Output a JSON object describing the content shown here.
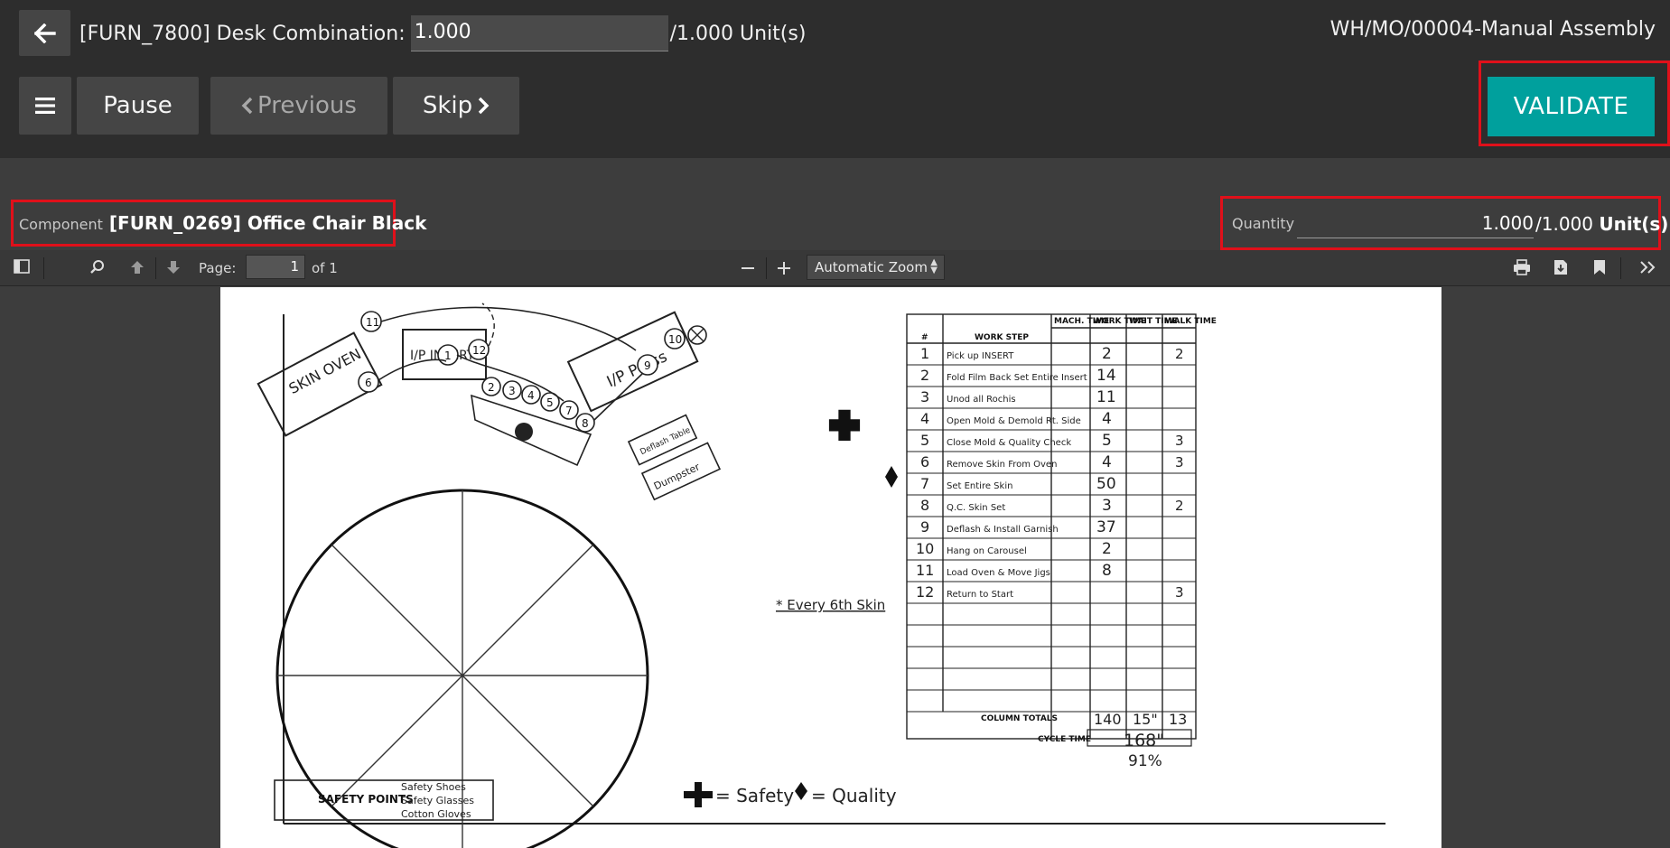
{
  "header": {
    "product": "[FURN_7800] Desk Combination:",
    "quantity_value": "1.000",
    "quantity_total": "/1.000 Unit(s)",
    "order_ref": "WH/MO/00004-Manual Assembly"
  },
  "toolbar": {
    "pause_label": "Pause",
    "previous_label": "Previous",
    "skip_label": "Skip",
    "validate_label": "VALIDATE"
  },
  "component": {
    "label": "Component",
    "value": "[FURN_0269] Office Chair Black"
  },
  "quantity": {
    "label": "Quantity",
    "done": "1.000",
    "total": "/1.000",
    "unit": "Unit(s)"
  },
  "pdf_viewer": {
    "page_label": "Page:",
    "page_number": "1",
    "page_of": "of 1",
    "zoom": "Automatic Zoom"
  },
  "worksheet": {
    "columns": [
      "#",
      "WORK STEP",
      "MACH. TIME",
      "WORK TIME",
      "WAIT TIME",
      "WALK TIME"
    ],
    "rows": [
      {
        "n": "1",
        "step": "Pick up INSERT",
        "work": "2",
        "walk": "2"
      },
      {
        "n": "2",
        "step": "Fold Film Back Set Entire Insert",
        "work": "14",
        "walk": ""
      },
      {
        "n": "3",
        "step": "Unod all Rochis",
        "work": "11",
        "walk": ""
      },
      {
        "n": "4",
        "step": "Open Mold & Demold Rt. Side",
        "work": "4",
        "walk": ""
      },
      {
        "n": "5",
        "step": "Close Mold & Quality Check",
        "work": "5",
        "walk": "3"
      },
      {
        "n": "6",
        "step": "Remove Skin From Oven",
        "work": "4",
        "walk": "3"
      },
      {
        "n": "7",
        "step": "Set Entire Skin",
        "work": "50",
        "walk": ""
      },
      {
        "n": "8",
        "step": "Q.C. Skin Set",
        "work": "3",
        "walk": "2"
      },
      {
        "n": "9",
        "step": "Deflash & Install Garnish",
        "work": "37",
        "walk": ""
      },
      {
        "n": "10",
        "step": "Hang on Carousel",
        "work": "2",
        "walk": ""
      },
      {
        "n": "11",
        "step": "Load Oven & Move Jigs",
        "work": "8",
        "walk": ""
      },
      {
        "n": "12",
        "step": "Return to Start",
        "work": "",
        "walk": "3"
      }
    ],
    "column_totals_label": "COLUMN TOTALS",
    "totals": {
      "work": "140",
      "wait": "15\"",
      "walk": "13"
    },
    "cycle_time_label": "CYCLE TIME",
    "cycle_time": "168\"",
    "percent": "91%",
    "note": "* Every 6th Skin",
    "legend_safety": "= Safety",
    "legend_quality": "= Quality",
    "safety_points_label": "SAFETY POINTS",
    "safety_items": [
      "Safety Shoes",
      "Safety Glasses",
      "Cotton Gloves"
    ],
    "diagram": {
      "skin_oven": "SKIN OVEN",
      "ip_inserts": "I/P INSERTS",
      "ip_press": "I/P Press",
      "deflash_table": "Deflash Table",
      "dumpster": "Dumpster"
    }
  }
}
